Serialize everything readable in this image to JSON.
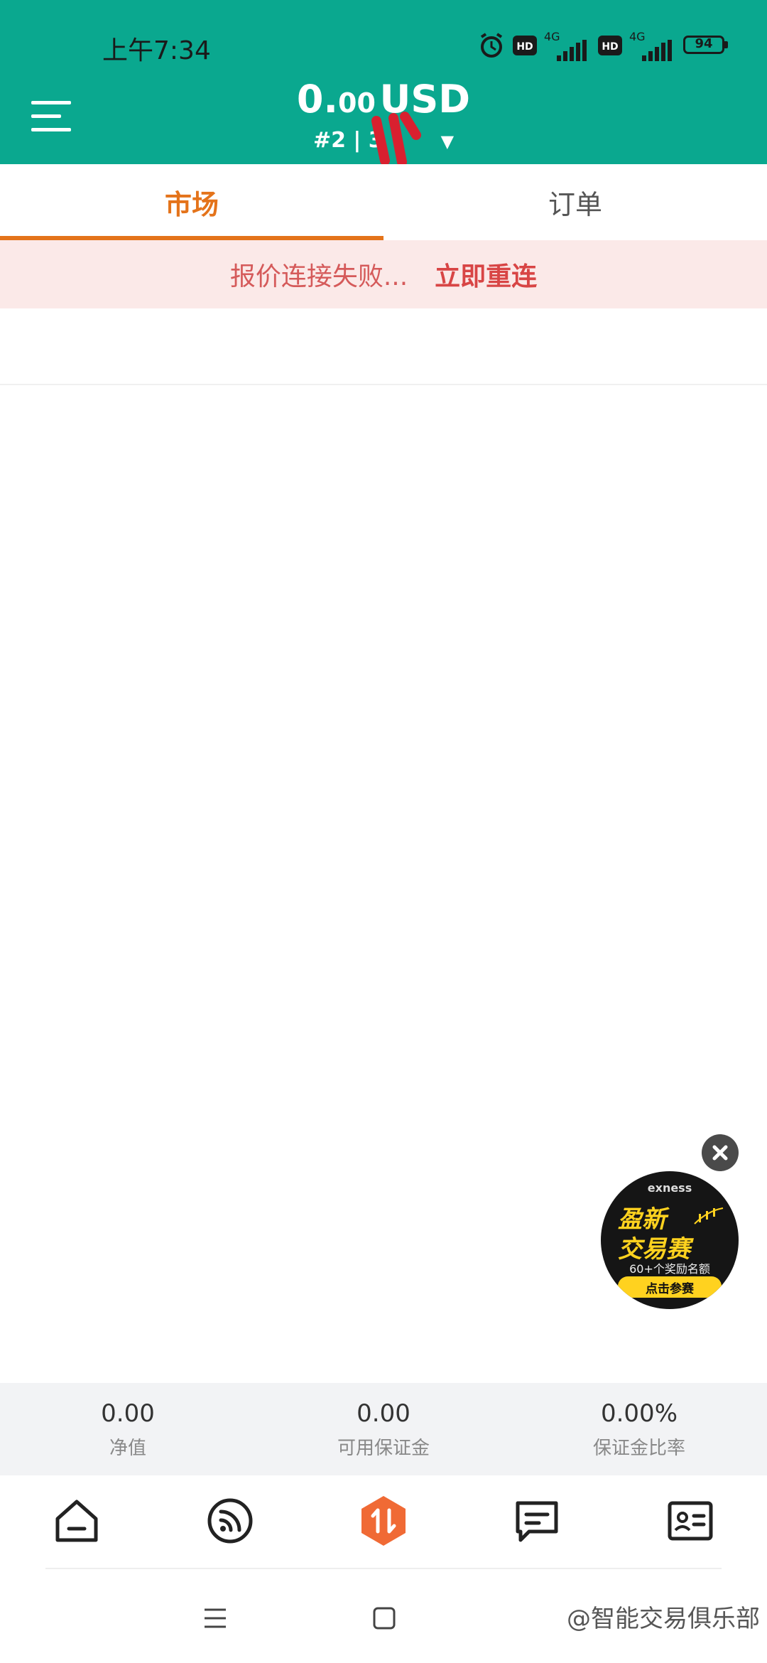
{
  "status_bar": {
    "time": "上午7:34",
    "battery": "94",
    "net1": "4G",
    "net2": "4G",
    "hd1": "HD",
    "hd2": "HD"
  },
  "header": {
    "balance_int": "0.",
    "balance_dec": "00",
    "currency": "USD",
    "account": "#2 | 3"
  },
  "tabs": [
    {
      "label": "市场",
      "active": true
    },
    {
      "label": "订单",
      "active": false
    }
  ],
  "error_bar": {
    "message": "报价连接失败...",
    "action": "立即重连"
  },
  "promo": {
    "brand": "exness",
    "line1": "盈新",
    "line2": "交易赛",
    "subtitle": "60+个奖励名额",
    "button": "点击参赛"
  },
  "stats": [
    {
      "value": "0.00",
      "label": "净值"
    },
    {
      "value": "0.00",
      "label": "可用保证金"
    },
    {
      "value": "0.00%",
      "label": "保证金比率"
    }
  ],
  "bottom_nav": [
    {
      "icon": "home-icon"
    },
    {
      "icon": "feed-icon"
    },
    {
      "icon": "trade-icon"
    },
    {
      "icon": "message-icon"
    },
    {
      "icon": "profile-card-icon"
    }
  ],
  "watermark": "@智能交易俱乐部",
  "colors": {
    "header": "#0aa88f",
    "accent": "#e4731a",
    "error_text": "#d55a5a",
    "error_bg": "#fbe9e8"
  }
}
